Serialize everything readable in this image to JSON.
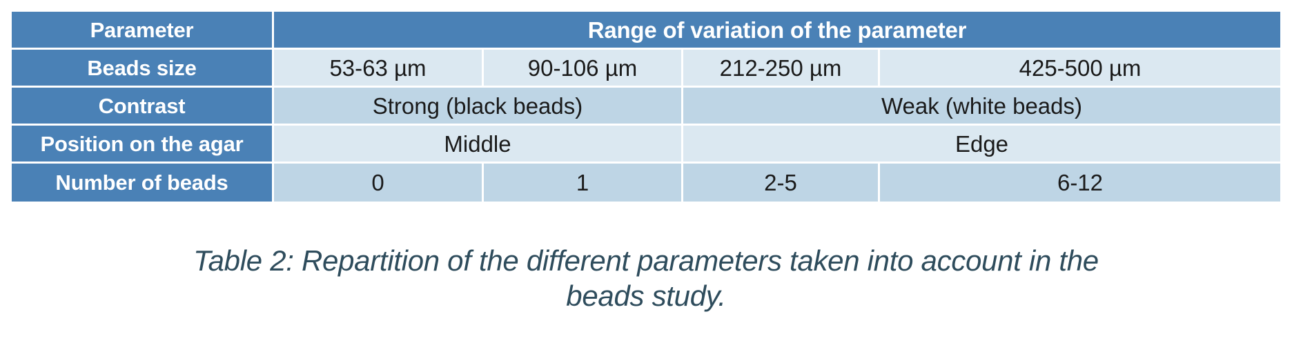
{
  "table": {
    "header": {
      "parameter_label": "Parameter",
      "range_label": "Range of variation of the parameter"
    },
    "rows": [
      {
        "label": "Beads size",
        "cells": [
          "53-63 µm",
          "90-106 µm",
          "212-250 µm",
          "425-500 µm"
        ]
      },
      {
        "label": "Contrast",
        "cells": [
          "Strong (black beads)",
          "Weak (white beads)"
        ]
      },
      {
        "label": "Position on the agar",
        "cells": [
          "Middle",
          "Edge"
        ]
      },
      {
        "label": "Number of beads",
        "cells": [
          "0",
          "1",
          "2-5",
          "6-12"
        ]
      }
    ]
  },
  "caption": {
    "line1": "Table 2: Repartition of the different parameters taken into account in the",
    "line2": "beads study."
  },
  "colors": {
    "header_blue": "#4a81b6",
    "cell_light": "#dbe8f1",
    "cell_mid": "#bed5e5",
    "caption_text": "#2e4c5c",
    "label_text": "#ffffff",
    "cell_text": "#1a1a1a"
  }
}
